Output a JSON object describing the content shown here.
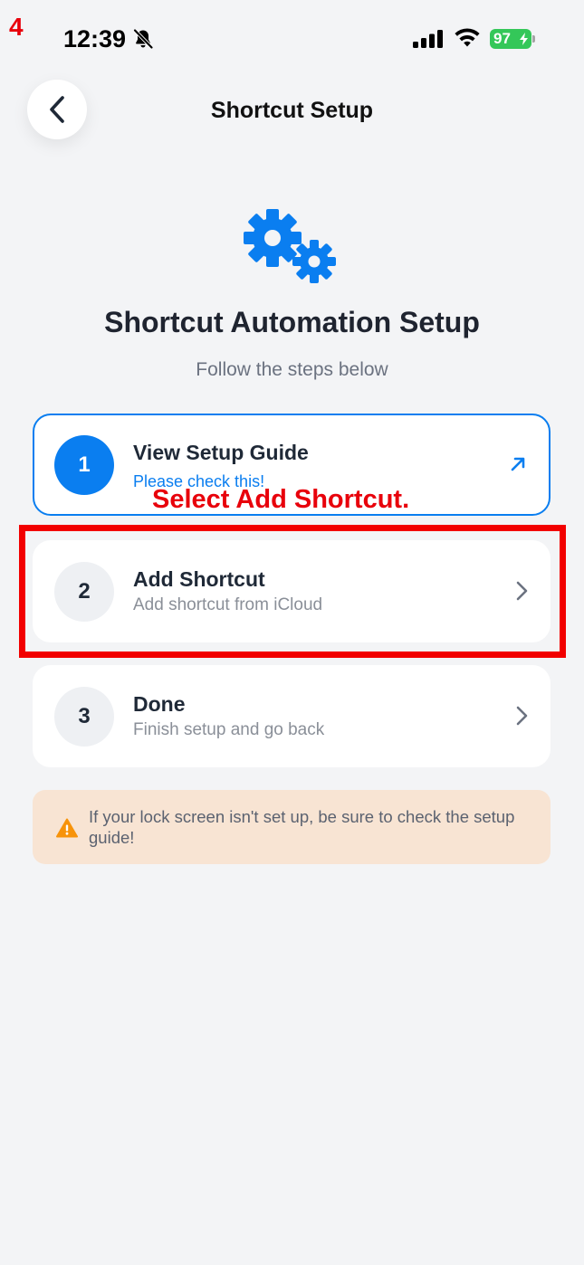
{
  "overlay": {
    "step_number": "4",
    "instruction": "Select Add Shortcut."
  },
  "status_bar": {
    "time": "12:39",
    "battery": "97"
  },
  "nav": {
    "title": "Shortcut Setup",
    "back_icon": "chevron-left-icon"
  },
  "header": {
    "icon": "gears-icon",
    "title": "Shortcut Automation Setup",
    "subtitle": "Follow the steps below"
  },
  "steps": [
    {
      "number": "1",
      "title": "View Setup Guide",
      "description": "Please check this!",
      "icon": "arrow-up-right-icon",
      "active": true
    },
    {
      "number": "2",
      "title": "Add Shortcut",
      "description": "Add shortcut from iCloud",
      "icon": "chevron-right-icon",
      "active": false
    },
    {
      "number": "3",
      "title": "Done",
      "description": "Finish setup and go back",
      "icon": "chevron-right-icon",
      "active": false
    }
  ],
  "warning": {
    "icon": "warning-triangle-icon",
    "text": "If your lock screen isn't set up, be sure to check the setup guide!"
  },
  "colors": {
    "accent": "#0a7ef0",
    "annotation_red": "#e8000b",
    "warning_bg": "#f8e4d3",
    "warning_icon": "#f7930a",
    "battery_green": "#34c759"
  }
}
